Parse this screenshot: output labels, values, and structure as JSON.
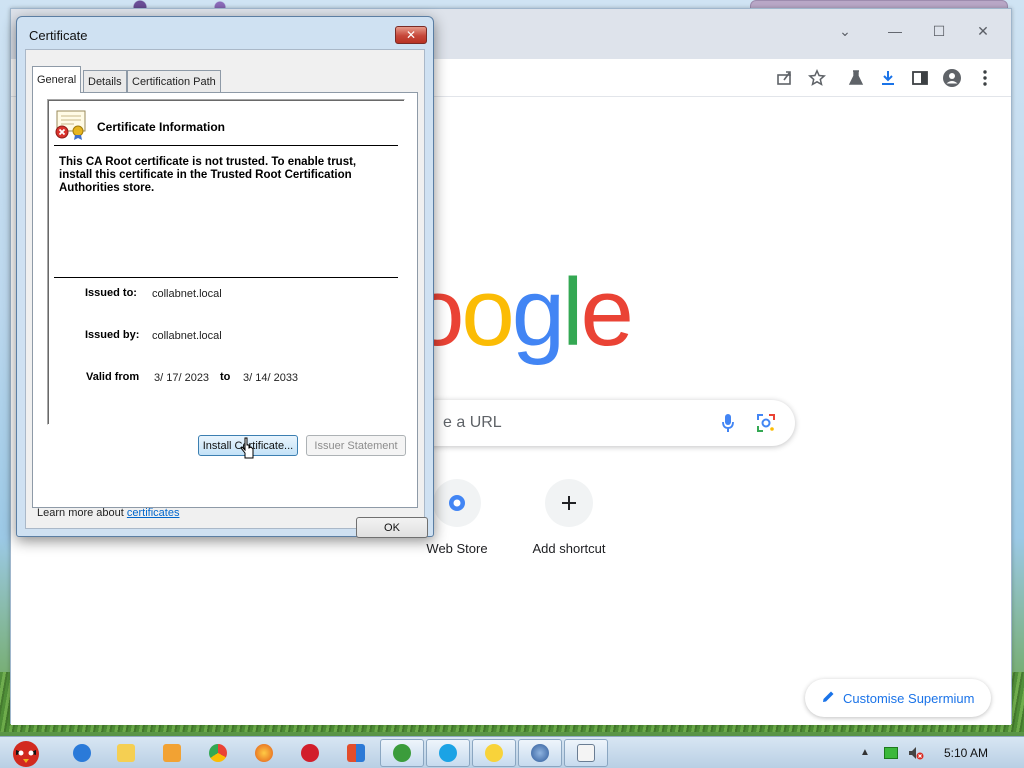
{
  "desktop": {},
  "browser": {
    "window_controls": [
      "minimize",
      "maximize",
      "close"
    ],
    "toolbar_icons": [
      "share-icon",
      "star-icon",
      "labs-icon",
      "download-icon",
      "sidebar-icon",
      "profile-icon",
      "menu-icon"
    ],
    "logo_text": [
      "o",
      "o",
      "g",
      "l",
      "e"
    ],
    "logo_colors": [
      "#ea4335",
      "#fbbc05",
      "#4285f4",
      "#34a853",
      "#ea4335"
    ],
    "search_placeholder": "e a URL",
    "shortcuts": [
      {
        "label": "Web Store"
      },
      {
        "label": "Add shortcut"
      }
    ],
    "customise_label": "Customise Supermium"
  },
  "dialog": {
    "title": "Certificate",
    "tabs": [
      "General",
      "Details",
      "Certification Path"
    ],
    "heading": "Certificate Information",
    "message": "This CA Root certificate is not trusted. To enable trust, install this certificate in the Trusted Root Certification Authorities store.",
    "issued_to_label": "Issued to:",
    "issued_to_value": "collabnet.local",
    "issued_by_label": "Issued by:",
    "issued_by_value": "collabnet.local",
    "valid_from_label": "Valid from",
    "valid_from_value": "3/ 17/ 2023",
    "valid_to_label": "to",
    "valid_to_value": "3/ 14/ 2033",
    "install_button": "Install Certificate...",
    "issuer_button": "Issuer Statement",
    "learn_prefix": "Learn more about ",
    "learn_link": "certificates",
    "ok_button": "OK"
  },
  "taskbar": {
    "clock": "5:10 AM"
  }
}
